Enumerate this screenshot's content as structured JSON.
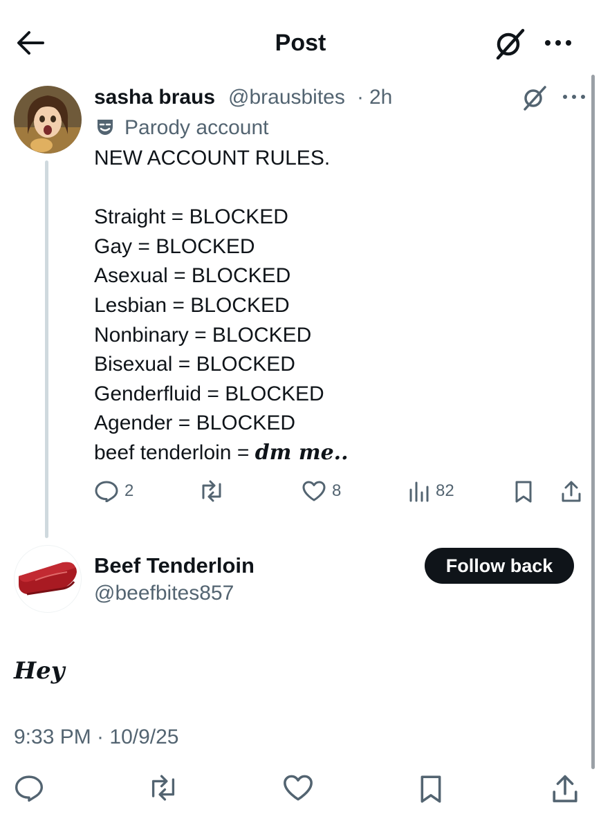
{
  "header": {
    "title": "Post",
    "back_icon": "arrow-left-icon",
    "grok_icon": "grok-icon",
    "more_icon": "more-icon"
  },
  "tweet": {
    "display_name": "sasha braus",
    "handle": "@brausbites",
    "separator": "·",
    "time_ago": "2h",
    "label": "Parody account",
    "body_lines": [
      "NEW ACCOUNT RULES.",
      "",
      "Straight = BLOCKED",
      "Gay = BLOCKED",
      "Asexual = BLOCKED",
      "Lesbian = BLOCKED",
      "Nonbinary = BLOCKED",
      "Bisexual = BLOCKED",
      "Genderfluid = BLOCKED",
      "Agender = BLOCKED"
    ],
    "last_line_prefix": "beef tenderloin = ",
    "last_line_fancy": "dm me..",
    "counts": {
      "replies": "2",
      "likes": "8",
      "views": "82"
    }
  },
  "reply": {
    "display_name": "Beef Tenderloin",
    "handle": "@beefbites857",
    "follow_label": "Follow back",
    "text": "Hey",
    "timestamp": "9:33 PM · 10/9/25"
  },
  "colors": {
    "text": "#0f1419",
    "muted": "#536471",
    "thread_line": "#cfd9de",
    "button_bg": "#0f1419"
  }
}
